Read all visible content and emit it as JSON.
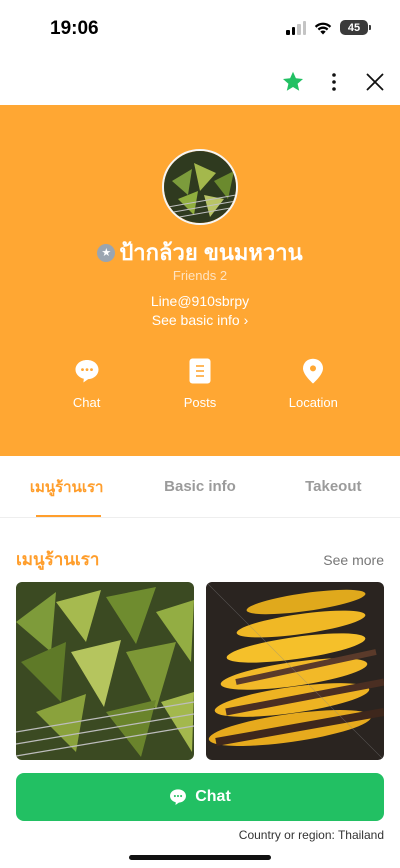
{
  "status_bar": {
    "time": "19:06",
    "battery": "45"
  },
  "top_bar": {
    "favorite_icon": "star-icon",
    "more_icon": "more-vertical-icon",
    "close_icon": "close-icon",
    "favorite_color": "#22C063"
  },
  "profile": {
    "name": "ป้ากล้วย ขนมหวาน",
    "verified_icon": "star-badge-icon",
    "friends": "Friends 2",
    "line_id": "Line@910sbrpy",
    "basic_info_link": "See basic info ›",
    "header_color": "#FFA733"
  },
  "actions": [
    {
      "label": "Chat",
      "icon": "chat-bubble-icon"
    },
    {
      "label": "Posts",
      "icon": "document-icon"
    },
    {
      "label": "Location",
      "icon": "location-pin-icon"
    }
  ],
  "tabs": [
    {
      "label": "เมนูร้านเรา",
      "active": true
    },
    {
      "label": "Basic info",
      "active": false
    },
    {
      "label": "Takeout",
      "active": false
    }
  ],
  "menu_section": {
    "title": "เมนูร้านเรา",
    "see_more": "See more"
  },
  "chat_button": {
    "label": "Chat",
    "color": "#22C063"
  },
  "footer": {
    "country": "Country or region: Thailand"
  }
}
